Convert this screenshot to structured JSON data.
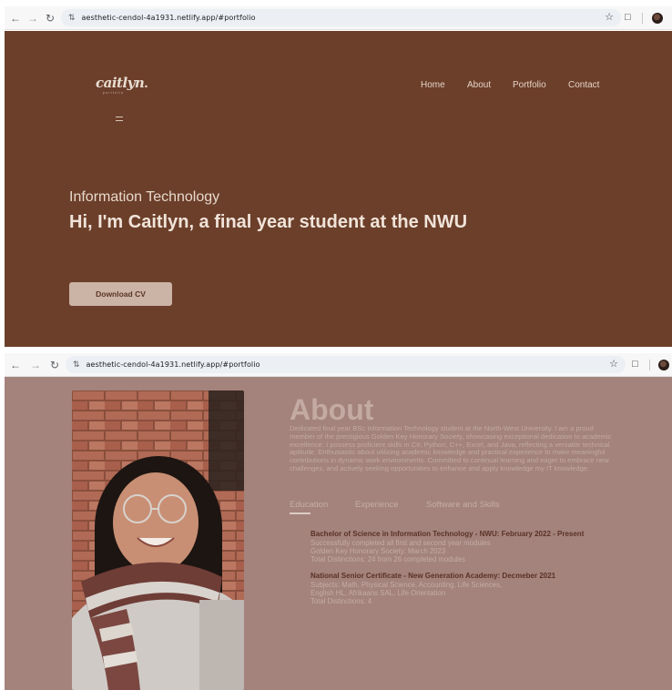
{
  "browser": {
    "url": "aesthetic-cendol-4a1931.netlify.app/#portfolio"
  },
  "colors": {
    "hero_bg": "#6c3f2a",
    "about_bg": "#a3837c",
    "button_bg": "#cbb3a6",
    "heading_dark": "#5a3126"
  },
  "hero": {
    "logo": {
      "word": "caitlyn",
      "dot": ".",
      "tagline": "portfolio"
    },
    "nav": [
      "Home",
      "About",
      "Portfolio",
      "Contact"
    ],
    "subtitle": "Information Technology",
    "title": "Hi, I'm Caitlyn, a final year student at the NWU",
    "button": "Download CV"
  },
  "about": {
    "heading": "About",
    "paragraph": "Dedicated final year BSc Information Technology student at the North-West University. I am a proud member of the prestigious Golden Key Honorary Society, showcasing exceptional dedication to academic excellence. I possess proficient skills in C#, Python, C++, Excel, and Java, reflecting a versatile technical aptitude. Enthusiastic about utilizing academic knowledge and practical experience to make meaningful contributions in dynamic work environments. Committed to continual learning and eager to embrace new challenges, and actively seeking opportunities to enhance and apply knowledge my IT knowledge.",
    "tabs": [
      "Education",
      "Experience",
      "Software and Skills"
    ],
    "active_tab": "Education",
    "education": [
      {
        "title": "Bachelor of Science in Information Technology - NWU: February 2022 - Present",
        "lines": [
          "Successfully completed all first and second year modules",
          "Golden Key Honorary Society: March 2023",
          "Total Distinctions: 24 from 26 completed modules"
        ]
      },
      {
        "title": "National Senior Certificate - New Generation Academy: Decmeber 2021",
        "lines": [
          "Subjects: Math, Physical Science, Accounting, Life Sciences,",
          "English HL, Afrikaans SAL, Life Orientation",
          "Total Distinctions: 4"
        ]
      }
    ]
  }
}
